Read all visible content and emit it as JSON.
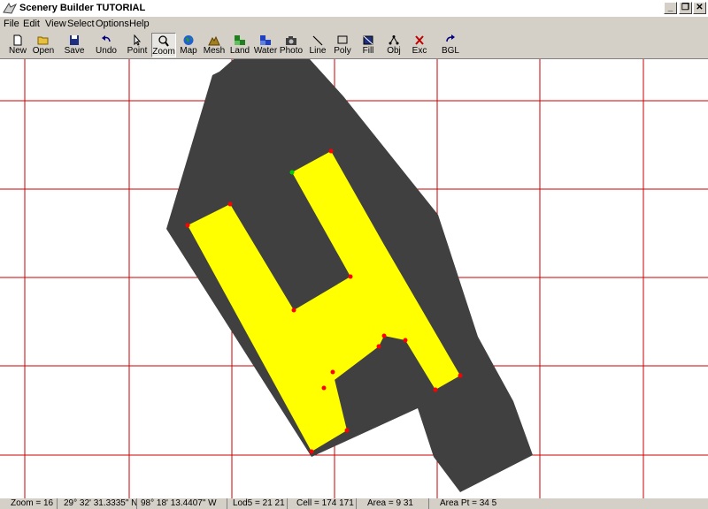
{
  "window": {
    "title": "Scenery Builder  TUTORIAL",
    "controls": {
      "minimize": "_",
      "restore": "❐",
      "close": "✕"
    }
  },
  "menu": [
    {
      "label": "File"
    },
    {
      "label": "Edit"
    },
    {
      "label": "View"
    },
    {
      "label": "Select"
    },
    {
      "label": "Options"
    },
    {
      "label": "Help"
    }
  ],
  "toolbar": [
    {
      "label": "New",
      "icon": "new-document-icon"
    },
    {
      "label": "Open",
      "icon": "folder-open-icon"
    },
    {
      "label": "Save",
      "icon": "floppy-disk-icon"
    },
    {
      "label": "Undo",
      "icon": "undo-arrow-icon"
    },
    {
      "label": "Point",
      "icon": "cursor-arrow-icon"
    },
    {
      "label": "Zoom",
      "icon": "magnifier-icon",
      "pressed": true
    },
    {
      "label": "Map",
      "icon": "globe-icon"
    },
    {
      "label": "Mesh",
      "icon": "mountain-mesh-icon"
    },
    {
      "label": "Land",
      "icon": "land-tiles-icon"
    },
    {
      "label": "Water",
      "icon": "water-tiles-icon"
    },
    {
      "label": "Photo",
      "icon": "camera-icon"
    },
    {
      "label": "Line",
      "icon": "line-tool-icon"
    },
    {
      "label": "Poly",
      "icon": "polygon-tool-icon"
    },
    {
      "label": "Fill",
      "icon": "fill-tool-icon"
    },
    {
      "label": "Obj",
      "icon": "object-tool-icon"
    },
    {
      "label": "Exc",
      "icon": "exclude-x-icon"
    },
    {
      "label": "BGL",
      "icon": "bgl-compile-icon"
    }
  ],
  "canvas": {
    "background": "#ffffff",
    "grid_color": "#cc0000",
    "outer_polygon_color": "#404040",
    "inner_polygon_color": "#ffff00",
    "vertex_color": "#ff0000",
    "selected_vertex_color": "#00cc00"
  },
  "status": {
    "zoom": "Zoom = 16",
    "latitude": "29° 32' 31.3335\" N",
    "longitude": "98° 18' 13.4407\" W",
    "lod5": "Lod5 = 21 21",
    "cell": "Cell = 174 171",
    "area": "Area = 9 31",
    "area_pt": "Area Pt = 34 5"
  }
}
